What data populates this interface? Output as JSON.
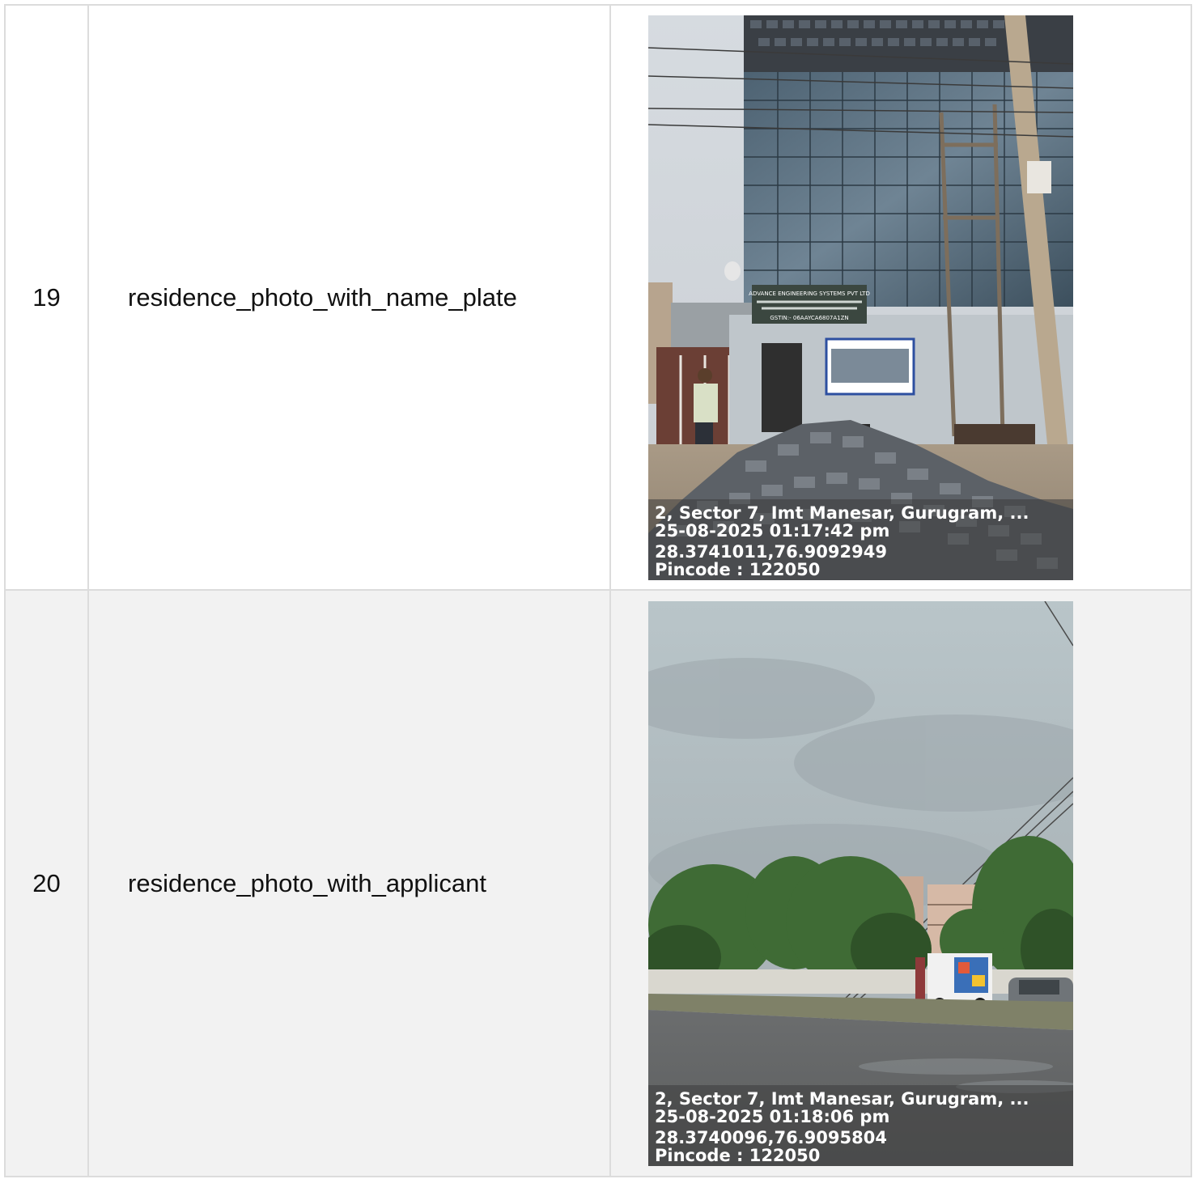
{
  "rows": [
    {
      "number": "19",
      "label": "residence_photo_with_name_plate",
      "photo": {
        "address": "2, Sector 7, Imt Manesar, Gurugram, ...",
        "datetime": "25-08-2025 01:17:42 pm",
        "coords": "28.3741011,76.9092949",
        "pincode": "Pincode : 122050",
        "sign_title": "ADVANCE ENGINEERING SYSTEMS PVT LTD",
        "sign_gstin": "GSTIN:- 06AAYCA6807A1ZN"
      }
    },
    {
      "number": "20",
      "label": "residence_photo_with_applicant",
      "photo": {
        "address": "2, Sector 7, Imt Manesar, Gurugram, ...",
        "datetime": "25-08-2025 01:18:06 pm",
        "coords": "28.3740096,76.9095804",
        "pincode": "Pincode : 122050"
      }
    }
  ]
}
